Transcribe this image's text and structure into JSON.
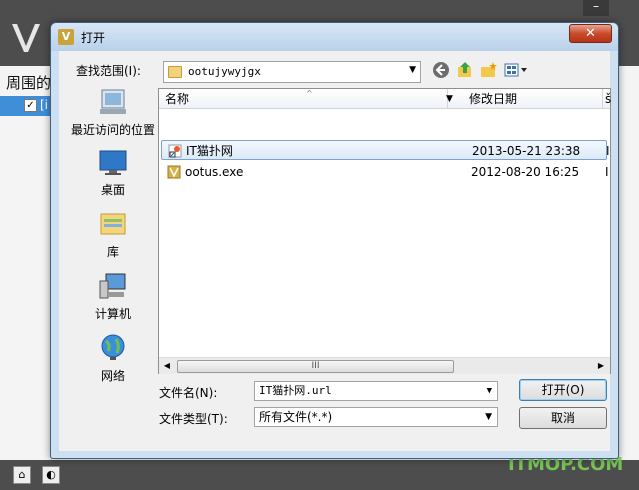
{
  "background_app": {
    "left_heading": "周围的",
    "left_row_text": "[i",
    "minimize_glyph": "–",
    "watermark": "ITMOP.COM"
  },
  "dialog": {
    "title": "打开",
    "close_glyph": "✕",
    "look_in_label": "查找范围(I):",
    "look_in_value": "ootujywyjgx",
    "toolbar": {
      "back_icon": "back-icon",
      "up_icon": "up-folder-icon",
      "new_folder_icon": "new-folder-icon",
      "views_icon": "views-menu-icon"
    },
    "places": [
      {
        "label": "最近访问的位置",
        "icon": "recent-places-icon"
      },
      {
        "label": "桌面",
        "icon": "desktop-icon"
      },
      {
        "label": "库",
        "icon": "library-icon"
      },
      {
        "label": "计算机",
        "icon": "computer-icon"
      },
      {
        "label": "网络",
        "icon": "network-icon"
      }
    ],
    "columns": {
      "name": "名称",
      "modified": "修改日期",
      "more": "š"
    },
    "files": [
      {
        "name": "IT猫扑网",
        "modified": "2013-05-21 23:38",
        "more": "I",
        "selected": true,
        "icon": "shortcut-icon"
      },
      {
        "name": "ootus.exe",
        "modified": "2012-08-20 16:25",
        "more": "I",
        "selected": false,
        "icon": "exe-icon"
      }
    ],
    "hscroll_grip": "III",
    "filename_label": "文件名(N):",
    "filename_value": "IT猫扑网.url",
    "filetype_label": "文件类型(T):",
    "filetype_value": "所有文件(*.*)",
    "open_button": "打开(O)",
    "cancel_button": "取消"
  }
}
